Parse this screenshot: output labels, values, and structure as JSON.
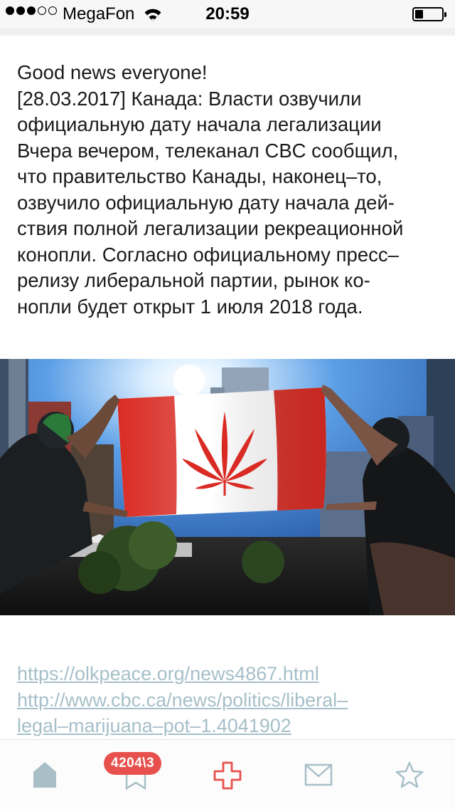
{
  "status_bar": {
    "carrier": "MegaFon",
    "time": "20:59",
    "signal_bars_filled": 3,
    "signal_bars_total": 5,
    "battery_level": 0.3
  },
  "post": {
    "lines": [
      "Good news everyone!",
      "[28.03.2017] Канада: Власти озвучили",
      "официальную дату начала легализации",
      "Вчера вечером, телеканал CBC сообщил,",
      "что правительство Канады, наконец–то,",
      "озвучило официальную дату начала дей-",
      "ствия полной легализации рекреационной",
      "конопли. Согласно официальному пресс–",
      "релизу либеральной партии, рынок ко-",
      "нопли будет открыт 1 июля 2018 года."
    ],
    "photo_icon": "cannabis-leaf-flag-photo",
    "links": [
      "https://olkpeace.org/news4867.html",
      "http://www.cbc.ca/news/politics/liberal–",
      "legal–marijuana–pot–1.4041902"
    ]
  },
  "tab_bar": {
    "tabs": [
      {
        "icon": "home-icon"
      },
      {
        "icon": "bookmark-icon",
        "badge": "4204\\3"
      },
      {
        "icon": "add-cross-icon"
      },
      {
        "icon": "mail-icon"
      },
      {
        "icon": "star-icon"
      }
    ]
  },
  "colors": {
    "link": "#a6bfc9",
    "accent_red": "#e8504d",
    "tab_icon": "#a8bfc8",
    "text": "#1a1a1a"
  }
}
